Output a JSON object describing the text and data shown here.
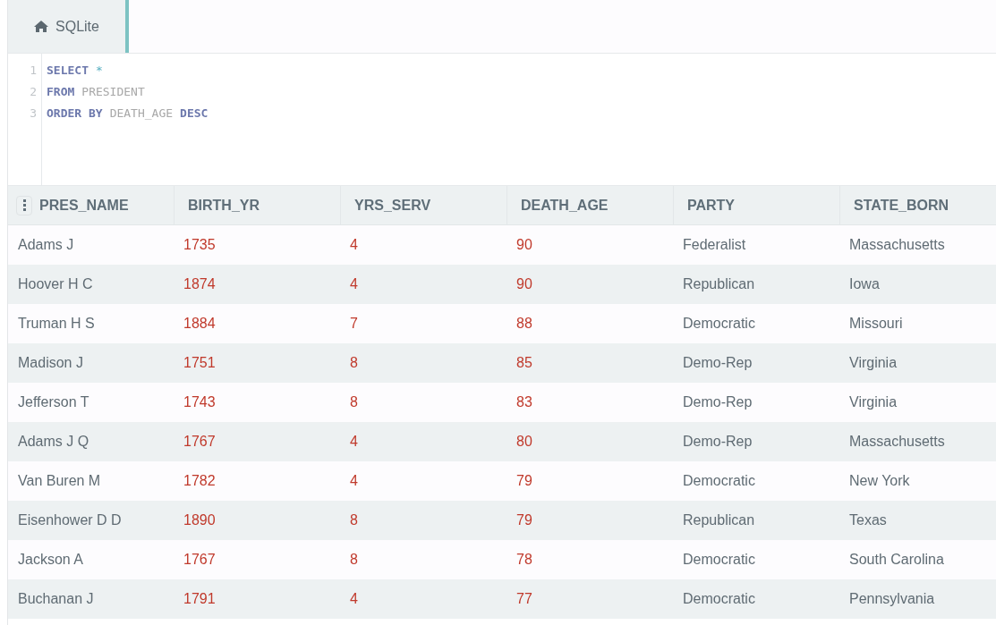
{
  "tab": {
    "label": "SQLite",
    "selected": true
  },
  "editor": {
    "lines": [
      {
        "number": "1",
        "tokens": [
          {
            "text": "SELECT",
            "kind": "keyword"
          },
          {
            "text": "*",
            "kind": "operator"
          }
        ]
      },
      {
        "number": "2",
        "tokens": [
          {
            "text": "FROM",
            "kind": "keyword"
          },
          {
            "text": "PRESIDENT",
            "kind": "identifier"
          }
        ]
      },
      {
        "number": "3",
        "tokens": [
          {
            "text": "ORDER BY",
            "kind": "keyword"
          },
          {
            "text": "DEATH_AGE",
            "kind": "identifier"
          },
          {
            "text": "DESC",
            "kind": "keyword"
          }
        ]
      }
    ]
  },
  "table": {
    "columns": [
      {
        "label": "PRES_NAME",
        "kind": "text"
      },
      {
        "label": "BIRTH_YR",
        "kind": "number"
      },
      {
        "label": "YRS_SERV",
        "kind": "number"
      },
      {
        "label": "DEATH_AGE",
        "kind": "number"
      },
      {
        "label": "PARTY",
        "kind": "text"
      },
      {
        "label": "STATE_BORN",
        "kind": "text"
      }
    ],
    "rows": [
      [
        "Adams J",
        "1735",
        "4",
        "90",
        "Federalist",
        "Massachusetts"
      ],
      [
        "Hoover H C",
        "1874",
        "4",
        "90",
        "Republican",
        "Iowa"
      ],
      [
        "Truman H S",
        "1884",
        "7",
        "88",
        "Democratic",
        "Missouri"
      ],
      [
        "Madison J",
        "1751",
        "8",
        "85",
        "Demo-Rep",
        "Virginia"
      ],
      [
        "Jefferson T",
        "1743",
        "8",
        "83",
        "Demo-Rep",
        "Virginia"
      ],
      [
        "Adams J Q",
        "1767",
        "4",
        "80",
        "Demo-Rep",
        "Massachusetts"
      ],
      [
        "Van Buren M",
        "1782",
        "4",
        "79",
        "Democratic",
        "New York"
      ],
      [
        "Eisenhower D D",
        "1890",
        "8",
        "79",
        "Republican",
        "Texas"
      ],
      [
        "Jackson A",
        "1767",
        "8",
        "78",
        "Democratic",
        "South Carolina"
      ],
      [
        "Buchanan J",
        "1791",
        "4",
        "77",
        "Democratic",
        "Pennsylvania"
      ]
    ]
  }
}
